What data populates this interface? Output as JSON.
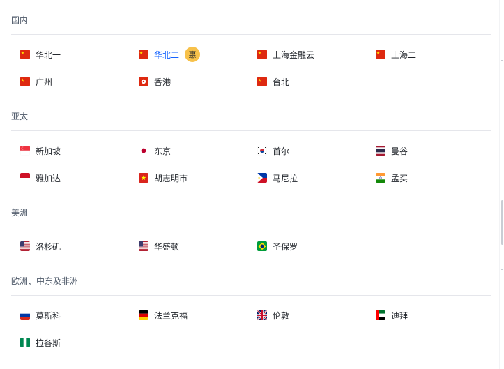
{
  "regions": [
    {
      "title": "国内",
      "items": [
        {
          "label": "华北一",
          "flag": "cn-flag-icon"
        },
        {
          "label": "华北二",
          "flag": "cn-flag-icon",
          "active": true,
          "badge": "惠"
        },
        {
          "label": "上海金融云",
          "flag": "cn-flag-icon"
        },
        {
          "label": "上海二",
          "flag": "cn-flag-icon"
        },
        {
          "label": "广州",
          "flag": "cn-flag-icon"
        },
        {
          "label": "香港",
          "flag": "hk-flag-icon"
        },
        {
          "label": "台北",
          "flag": "cn-flag-icon"
        }
      ]
    },
    {
      "title": "亚太",
      "items": [
        {
          "label": "新加坡",
          "flag": "sg-flag-icon"
        },
        {
          "label": "东京",
          "flag": "jp-flag-icon"
        },
        {
          "label": "首尔",
          "flag": "kr-flag-icon"
        },
        {
          "label": "曼谷",
          "flag": "th-flag-icon"
        },
        {
          "label": "雅加达",
          "flag": "id-flag-icon"
        },
        {
          "label": "胡志明市",
          "flag": "vn-flag-icon"
        },
        {
          "label": "马尼拉",
          "flag": "ph-flag-icon"
        },
        {
          "label": "孟买",
          "flag": "in-flag-icon"
        }
      ]
    },
    {
      "title": "美洲",
      "items": [
        {
          "label": "洛杉矶",
          "flag": "us-flag-icon"
        },
        {
          "label": "华盛顿",
          "flag": "us-flag-icon"
        },
        {
          "label": "圣保罗",
          "flag": "br-flag-icon"
        }
      ]
    },
    {
      "title": "欧洲、中东及非洲",
      "items": [
        {
          "label": "莫斯科",
          "flag": "ru-flag-icon"
        },
        {
          "label": "法兰克福",
          "flag": "de-flag-icon"
        },
        {
          "label": "伦敦",
          "flag": "gb-flag-icon"
        },
        {
          "label": "迪拜",
          "flag": "ae-flag-icon"
        },
        {
          "label": "拉各斯",
          "flag": "ng-flag-icon"
        }
      ]
    }
  ],
  "colors": {
    "active_text": "#1664ff",
    "badge_bg": "#f7c14a",
    "divider": "#e5e6eb",
    "section_title": "#4e5969"
  }
}
